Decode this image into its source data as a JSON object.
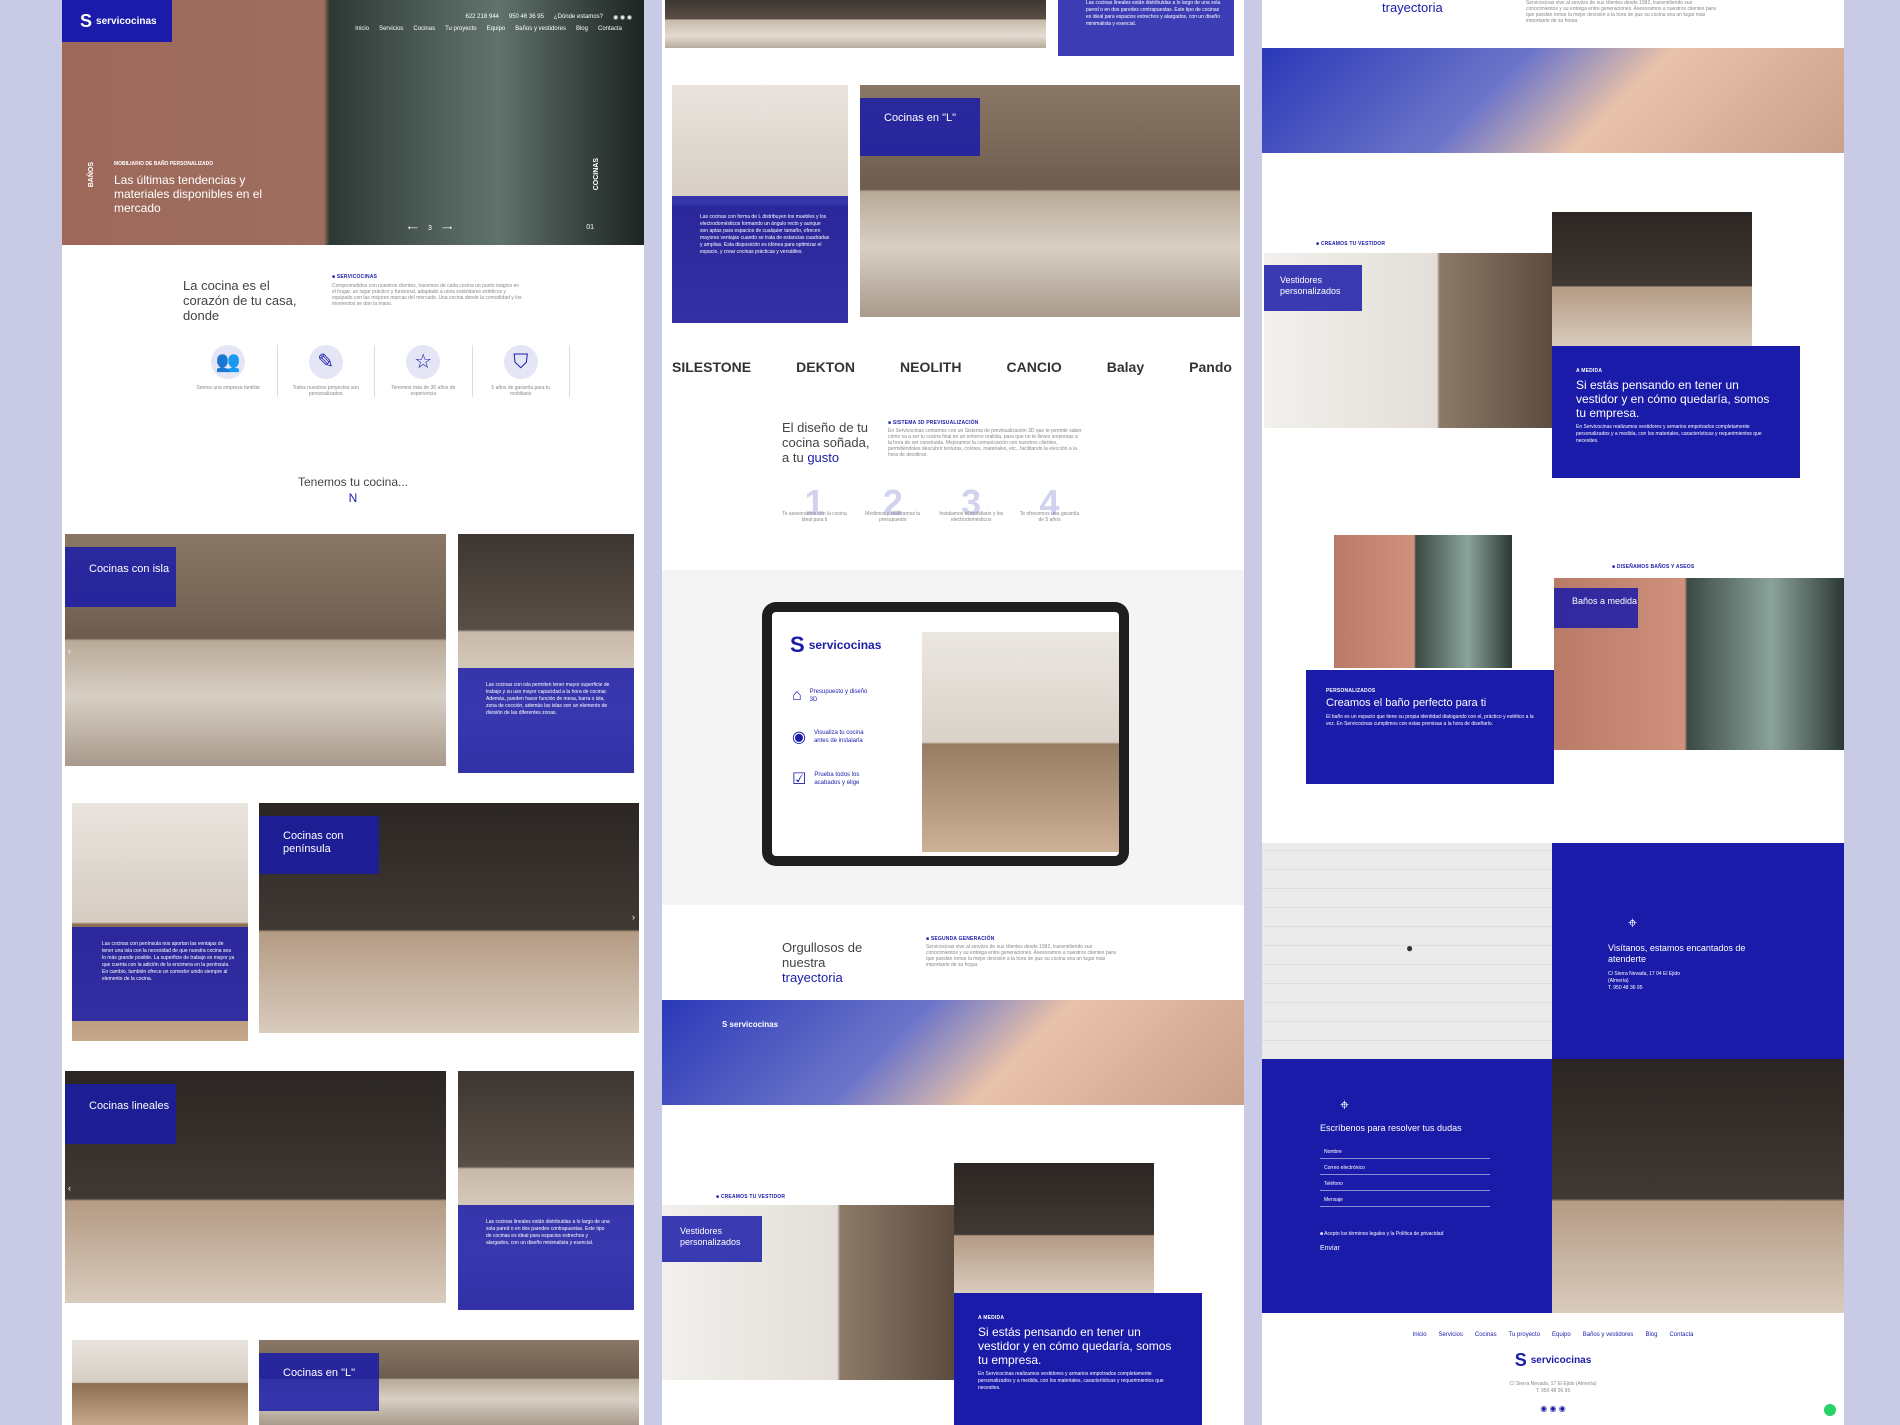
{
  "nav": {
    "logo": "servicocinas",
    "items": [
      "Inicio",
      "Servicios",
      "Cocinas",
      "Tu proyecto",
      "Equipo",
      "Baños y vestidores",
      "Blog",
      "Contacta"
    ],
    "phone1": "622 218 944",
    "phone2": "950 46 36 95",
    "location": "¿Dónde estamos?"
  },
  "hero": {
    "label": "MOBILIARIO DE BAÑO PERSONALIZADO",
    "title": "Las últimas tendencias y materiales disponibles en el mercado",
    "side_left": "BAÑOS",
    "side_right": "COCINAS",
    "slide_num": "3",
    "slide_right": "01"
  },
  "intro": {
    "heading": "La cocina es el corazón de tu casa, donde",
    "label": "SERVICOCINAS",
    "text": "Comprometidos con nuestros clientes, hacemos de cada cocina un punto mágico en el hogar, un lugar práctico y funcional, adaptado a unos estándares estéticos y equipado con las mejores marcas del mercado. Una cocina donde la comodidad y los momentos se dan la mano."
  },
  "features": [
    {
      "icon": "team-icon",
      "text": "Somos una empresa familiar"
    },
    {
      "icon": "pencil-icon",
      "text": "Todos nuestros proyectos son personalizados"
    },
    {
      "icon": "star-icon",
      "text": "Tenemos más de 30 años de experiencia"
    },
    {
      "icon": "shield-icon",
      "text": "5 años de garantía para tu mobiliario"
    }
  ],
  "kitchens_heading": "Tenemos tu cocina...",
  "kitchens_letter": "N",
  "kitchens": [
    {
      "title": "Cocinas con isla",
      "text": "Las cocinas con isla permiten tener mayor superficie de trabajo y su uso mayor capacidad a la hora de cocinar. Además, pueden hacer función de mesa, barra o isla, zona de cocción, además las islas son un elemento de división de las diferentes zonas."
    },
    {
      "title": "Cocinas con península",
      "text": "Las cocinas con península nos aportan las ventajas de tener una isla con la necesidad de que nuestra cocina sea lo más grande posible. La superficie de trabajo es mayor ya que cuenta con la adición de la encimera en la península. En cambio, también ofrece un comedor unido siempre al elemento de la cocina."
    },
    {
      "title": "Cocinas lineales",
      "text": "Las cocinas lineales están distribuidas a lo largo de una sola pared o en dos paredes contrapuestas. Este tipo de cocinas es ideal para espacios estrechos y alargados, con un diseño minimalista y esencial."
    },
    {
      "title": "Cocinas en \"L\"",
      "text": "Las cocinas con forma de L distribuyen los muebles y los electrodomésticos formando un ángulo recto y aunque son aptas para espacios de cualquier tamaño, ofrecen mayores ventajas cuando se trata de estancias cuadradas y amplias. Esta disposición es idónea para optimizar el espacio, y crear cocinas prácticas y versátiles."
    }
  ],
  "brands": [
    "SILESTONE",
    "DEKTON",
    "NEOLITH",
    "CANCIO",
    "Balay",
    "Pando"
  ],
  "design": {
    "heading_pre": "El diseño de tu cocina soñada, a tu",
    "heading_accent": "gusto",
    "label": "SISTEMA 3D PREVISUALIZACIÓN",
    "text": "En Servicocinas contamos con un Sistema de previsualización 3D que te permite saber cómo va a ser tu cocina final en un entorno realista, para que no te lleves sorpresas a la hora de ser construida. Mejoramos la comunicación con nuestros clientes, permitiéndoles descubrir texturas, colores, materiales, etc., facilitando la elección a la hora de decidirse.",
    "steps": [
      {
        "num": "1",
        "text": "Te asesoramos con la cocina ideal para ti"
      },
      {
        "num": "2",
        "text": "Medimos y realizamos tu presupuesto"
      },
      {
        "num": "3",
        "text": "Instalamos el mobiliario y los electrodomésticos"
      },
      {
        "num": "4",
        "text": "Te ofrecemos una garantía de 5 años"
      }
    ]
  },
  "tablet": {
    "logo": "servicocinas",
    "items": [
      "Presupuesto y diseño 3D",
      "Visualiza tu cocina antes de instalarla",
      "Prueba todos los acabados y elige"
    ]
  },
  "trajectory": {
    "heading_pre": "Orgullosos de nuestra",
    "heading_accent": "trayectoria",
    "label": "SEGUNDA GENERACIÓN",
    "text": "Servicocinas vive al servicio de sus clientes desde 1992, transmitiendo sus conocimientos y su entrega entre generaciones. Asesoramos a nuestros clientes para que puedan tomar la mejor decisión a la hora de que su cocina sea un lugar más importante de su hogar."
  },
  "wardrobe": {
    "label": "CREAMOS TU VESTIDOR",
    "tag": "Vestidores personalizados",
    "box_label": "A MEDIDA",
    "box_title": "Si estás pensando en tener un vestidor y en cómo quedaría, somos tu empresa.",
    "box_text": "En Servicocinas realizamos vestidores y armarios empotrados completamente personalizados y a medida, con los materiales, características y requerimientos que necesites."
  },
  "bath": {
    "label": "DISEÑAMOS BAÑOS Y ASEOS",
    "tag": "Baños a medida",
    "box_label": "PERSONALIZADOS",
    "box_title": "Creamos el baño perfecto para ti",
    "box_text": "El baño es un espacio que tiene su propia identidad dialogando con el, práctico y estético a la vez. En Servicocinas cumplimos con estas premisas a la hora de diseñarlo."
  },
  "visit": {
    "title": "Visítanos, estamos encantados de atenderte",
    "address": "C/ Sierra Nevada, 17 04 El Ejido (Almería)",
    "phone": "T. 950 48 36 95"
  },
  "contact": {
    "title": "Escríbenos para resolver tus dudas",
    "fields": [
      "Nombre",
      "Correo electrónico",
      "Teléfono",
      "Mensaje"
    ],
    "accept": "Acepto los términos legales y la Política de privacidad",
    "submit": "Enviar"
  },
  "footer": {
    "items": [
      "Inicio",
      "Servicios",
      "Cocinas",
      "Tu proyecto",
      "Equipo",
      "Baños y vestidores",
      "Blog",
      "Contacta"
    ],
    "logo": "servicocinas",
    "address": "C/ Sierra Nevada, 17 El Ejido (Almería)",
    "phone": "T. 950 48 36 95"
  },
  "colors": {
    "accent": "#1a1ba8",
    "background": "#c9cbe6"
  }
}
